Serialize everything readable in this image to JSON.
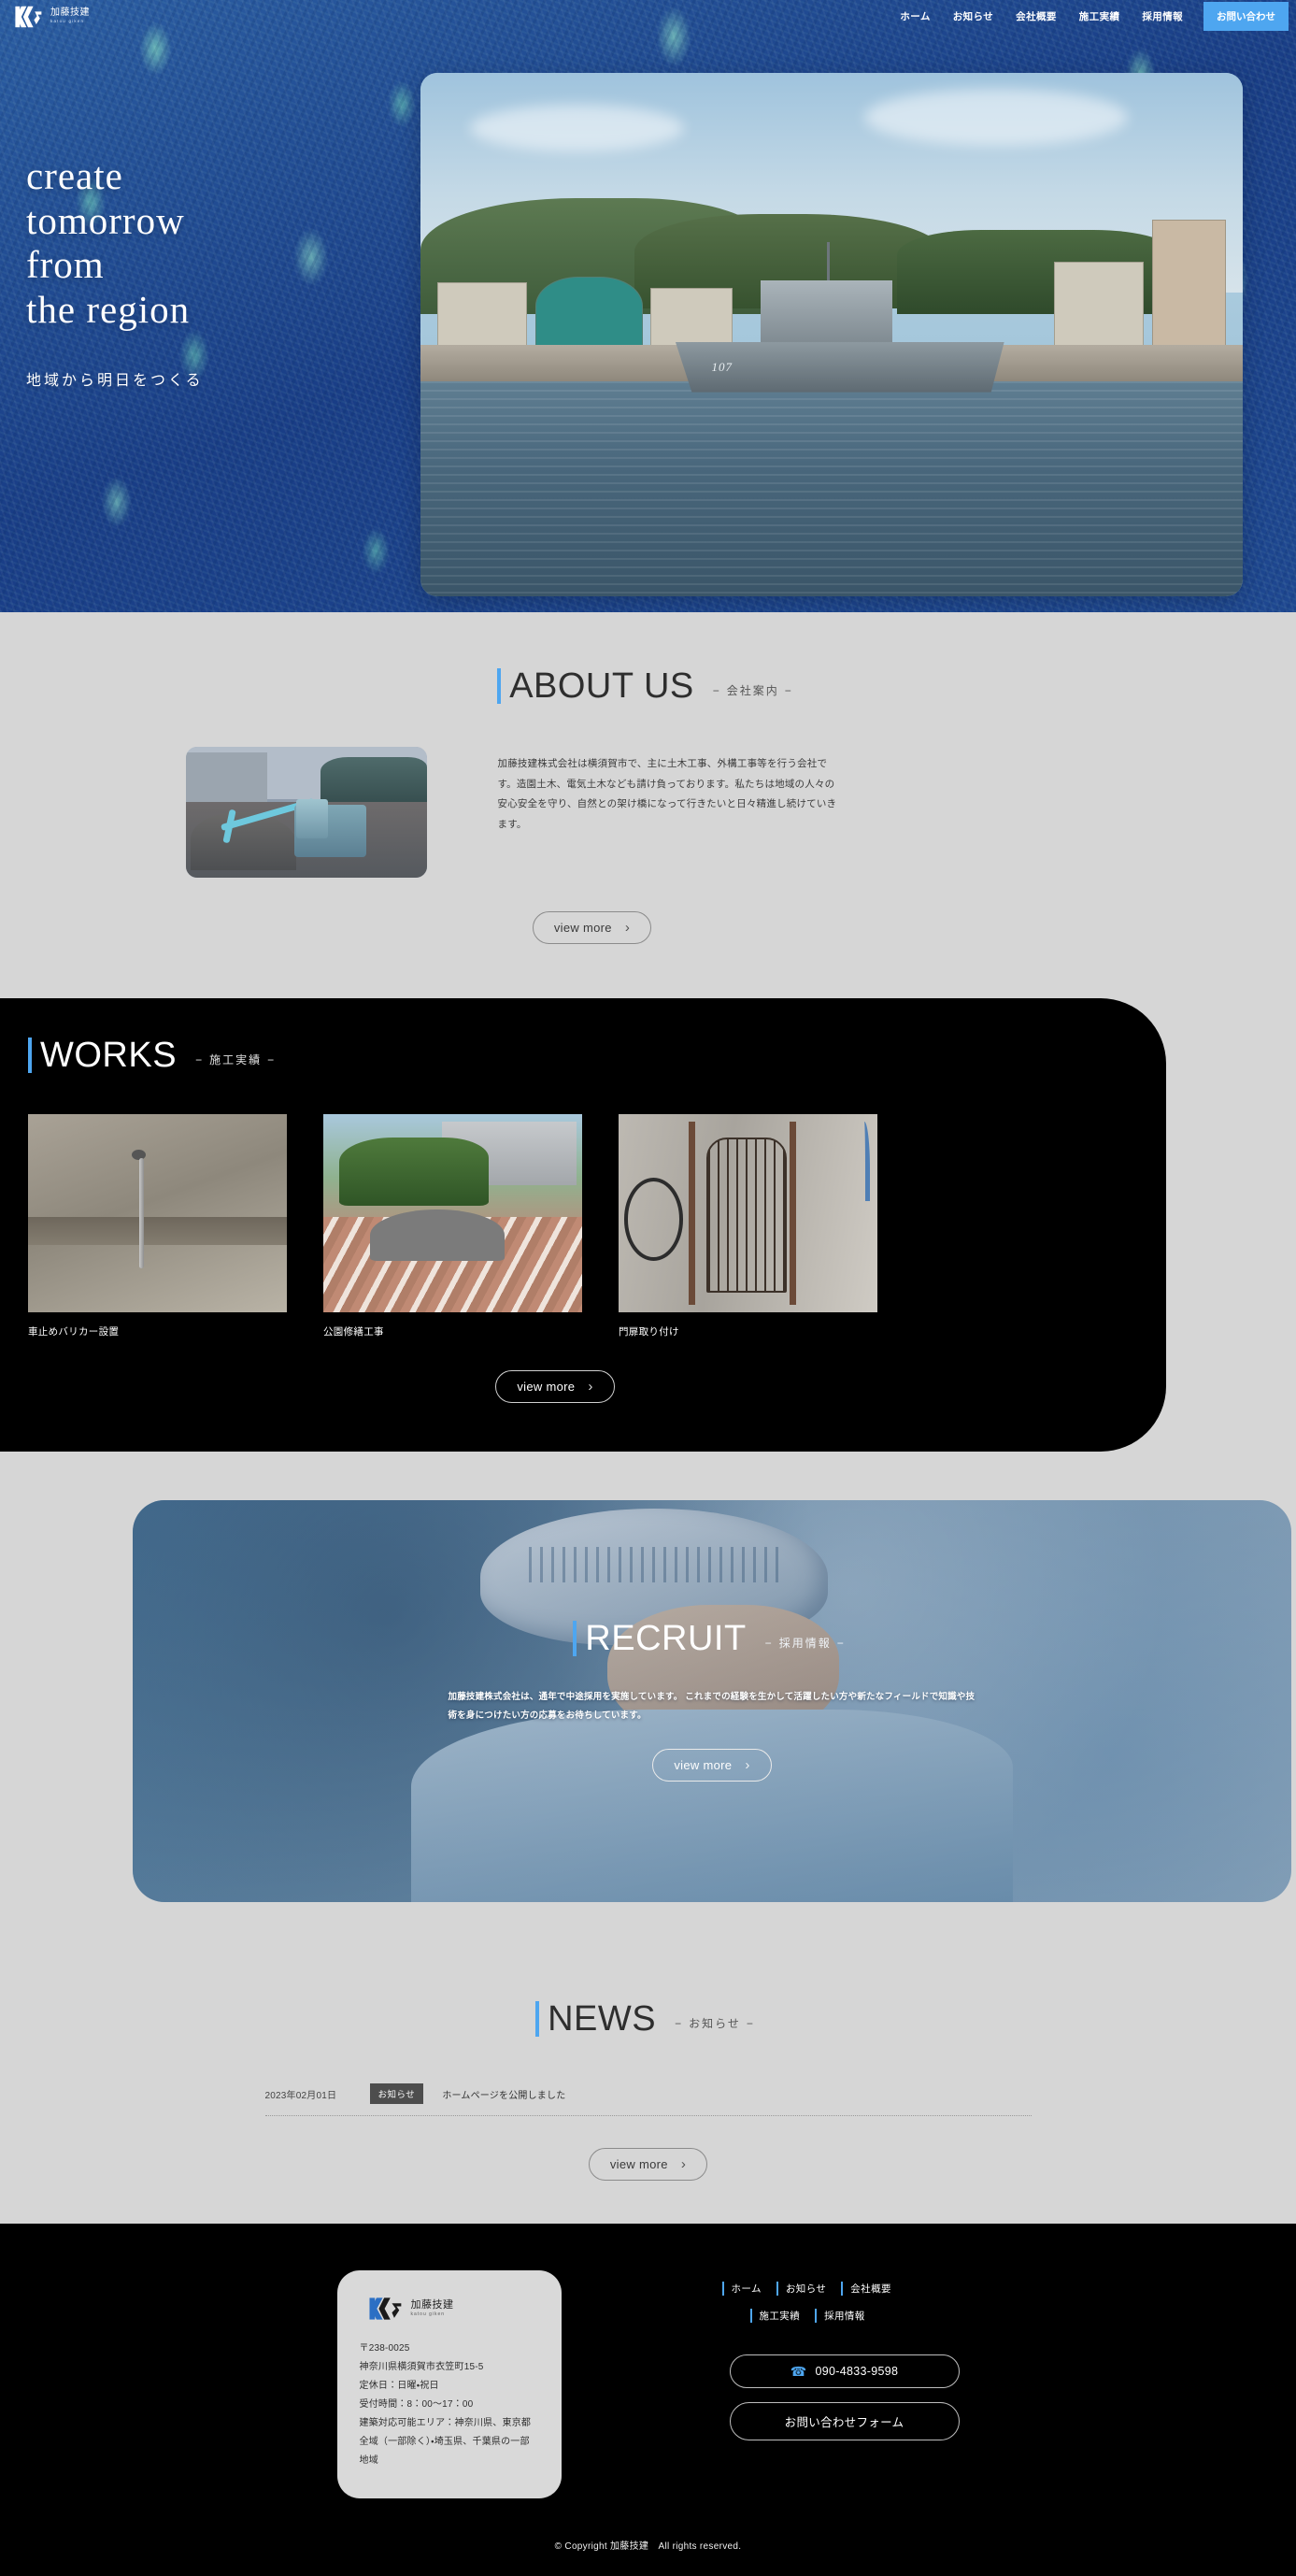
{
  "brand": {
    "name_ja": "加藤技建",
    "name_en": "katou giken",
    "logo_icon": "kg-monogram-logo"
  },
  "header": {
    "nav": [
      {
        "label": "ホーム"
      },
      {
        "label": "お知らせ"
      },
      {
        "label": "会社概要"
      },
      {
        "label": "施工実績"
      },
      {
        "label": "採用情報"
      }
    ],
    "contact_button": "お問い合わせ",
    "accent_color": "#4ea6f0"
  },
  "hero": {
    "title_lines": [
      "create",
      "tomorrow",
      "from",
      "the  region"
    ],
    "subtitle": "地域から明日をつくる",
    "photo_caption": "107"
  },
  "about": {
    "heading_en": "ABOUT US",
    "heading_ja": "会社案内",
    "dash": "−",
    "body": "加藤技建株式会社は横須賀市で、主に土木工事、外構工事等を行う会社です。造園土木、電気土木なども請け負っております。私たちは地域の人々の安心安全を守り、自然との架け橋になって行きたいと日々精進し続けていきます。",
    "view_more": "view more",
    "chevron_icon": "chevron-right-icon"
  },
  "works": {
    "heading_en": "WORKS",
    "heading_ja": "施工実績",
    "dash": "−",
    "items": [
      {
        "caption": "車止めバリカー設置"
      },
      {
        "caption": "公園修繕工事"
      },
      {
        "caption": "門扉取り付け"
      }
    ],
    "view_more": "view more"
  },
  "recruit": {
    "heading_en": "RECRUIT",
    "heading_ja": "採用情報",
    "dash": "−",
    "body": "加藤技建株式会社は、通年で中途採用を実施しています。 これまでの経験を生かして活躍したい方や新たなフィールドで知識や技術を身につけたい方の応募をお待ちしています。",
    "view_more": "view more"
  },
  "news": {
    "heading_en": "NEWS",
    "heading_ja": "お知らせ",
    "dash": "−",
    "items": [
      {
        "date": "2023年02月01日",
        "badge": "お知らせ",
        "title": "ホームページを公開しました"
      }
    ],
    "view_more": "view more"
  },
  "footer": {
    "company_card": {
      "name_ja": "加藤技建",
      "name_en": "katou giken",
      "postal": "〒238-0025",
      "address": "神奈川県横須賀市衣笠町15-5",
      "holiday": "定休日：日曜・祝日",
      "hours": "受付時間：8：00〜17：00",
      "area": "建築対応可能エリア：神奈川県、東京都全域（一部除く）・埼玉県、千葉県の一部地域"
    },
    "nav_row1": [
      {
        "label": "ホーム"
      },
      {
        "label": "お知らせ"
      },
      {
        "label": "会社概要"
      }
    ],
    "nav_row2": [
      {
        "label": "施工実績"
      },
      {
        "label": "採用情報"
      }
    ],
    "phone": "090-4833-9598",
    "phone_icon": "phone-icon",
    "contact_form_button": "お問い合わせフォーム",
    "copyright": "© Copyright 加藤技建　All rights reserved."
  }
}
